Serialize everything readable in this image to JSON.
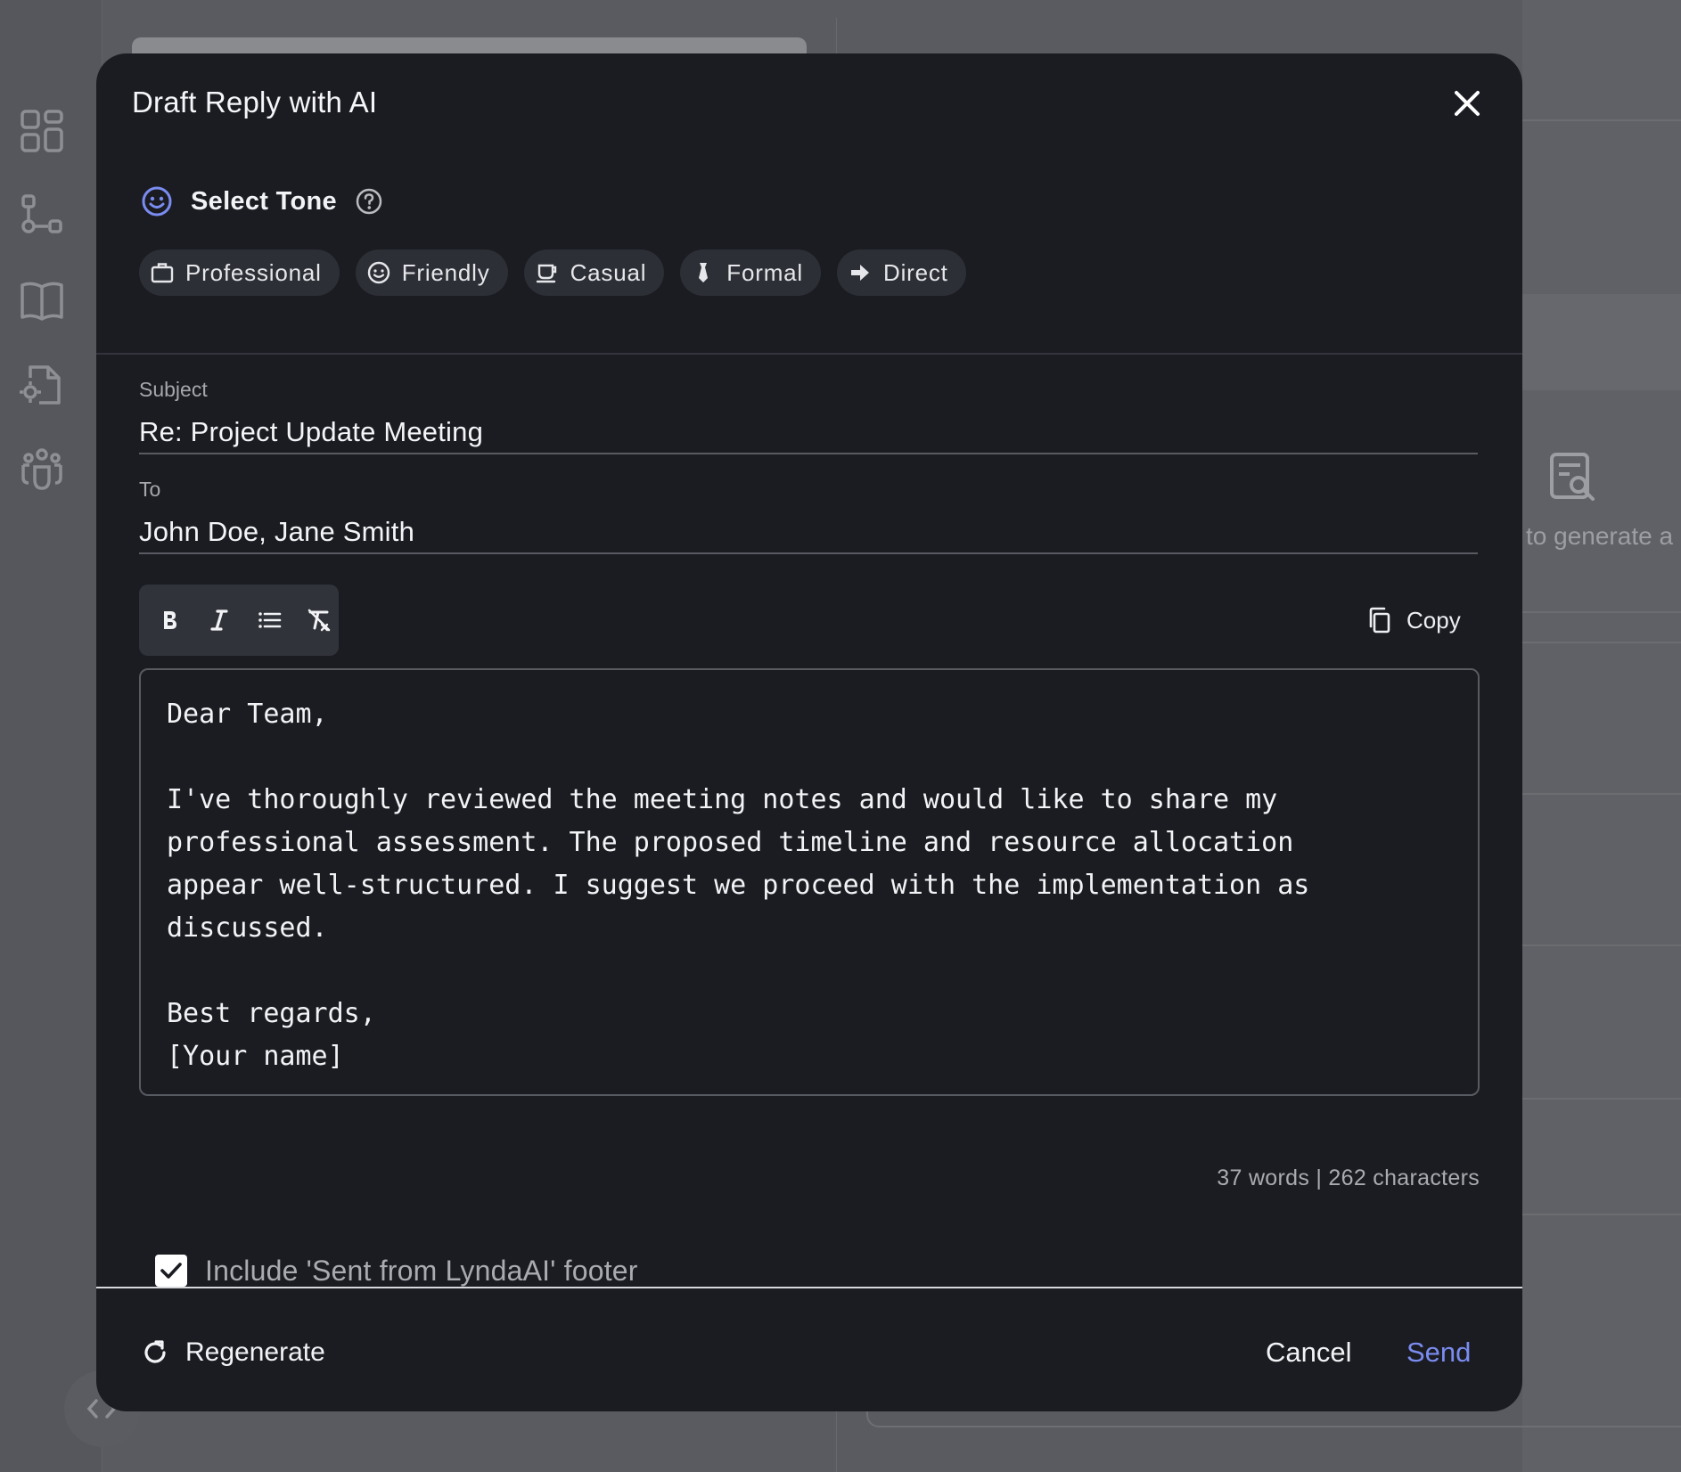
{
  "background": {
    "hint_text": "to generate a",
    "sidebar_icons": [
      "dashboard-icon",
      "workflow-icon",
      "book-icon",
      "file-settings-icon",
      "team-icon"
    ]
  },
  "modal": {
    "title": "Draft Reply with AI",
    "tone": {
      "label": "Select Tone",
      "options": [
        {
          "label": "Professional",
          "icon": "briefcase-icon"
        },
        {
          "label": "Friendly",
          "icon": "smile-icon"
        },
        {
          "label": "Casual",
          "icon": "coffee-icon"
        },
        {
          "label": "Formal",
          "icon": "tie-icon"
        },
        {
          "label": "Direct",
          "icon": "arrow-right-icon"
        }
      ]
    },
    "subject": {
      "label": "Subject",
      "value": "Re: Project Update Meeting"
    },
    "to": {
      "label": "To",
      "value": "John Doe, Jane Smith"
    },
    "toolbar": {
      "bold": "bold-icon",
      "italic": "italic-icon",
      "list": "list-icon",
      "clear": "clear-format-icon",
      "copy_label": "Copy"
    },
    "body": "Dear Team,\n\nI've thoroughly reviewed the meeting notes and would like to share my\nprofessional assessment. The proposed timeline and resource allocation\nappear well-structured. I suggest we proceed with the implementation as\ndiscussed.\n\nBest regards,\n[Your name]",
    "counter": "37 words | 262 characters",
    "footer_option": {
      "label": "Include 'Sent from LyndaAI' footer",
      "checked": true
    },
    "actions": {
      "regenerate": "Regenerate",
      "cancel": "Cancel",
      "send": "Send"
    }
  },
  "colors": {
    "modal_bg": "#1b1c22",
    "chip_bg": "#2d2f37",
    "accent": "#7a8cf0",
    "overlay": "#4d4f55"
  }
}
